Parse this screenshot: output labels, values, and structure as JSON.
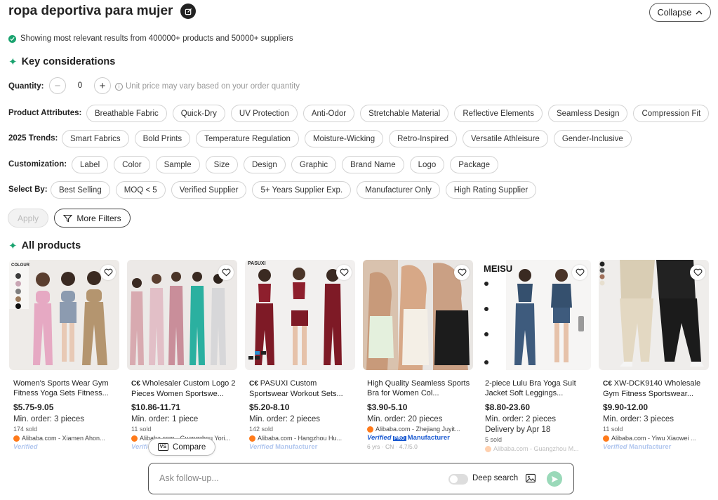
{
  "header": {
    "title": "ropa deportiva para mujer",
    "collapse_label": "Collapse"
  },
  "summary": {
    "showing_text": "Showing most relevant results from 400000+ products and 50000+ suppliers"
  },
  "key_considerations": {
    "heading": "Key considerations",
    "quantity_label": "Quantity:",
    "quantity_value": "0",
    "quantity_note": "Unit price may vary based on your order quantity",
    "product_attributes_label": "Product Attributes:",
    "product_attributes": [
      "Breathable Fabric",
      "Quick-Dry",
      "UV Protection",
      "Anti-Odor",
      "Stretchable Material",
      "Reflective Elements",
      "Seamless Design",
      "Compression Fit"
    ],
    "trends_label": "2025 Trends:",
    "trends": [
      "Smart Fabrics",
      "Bold Prints",
      "Temperature Regulation",
      "Moisture-Wicking",
      "Retro-Inspired",
      "Versatile Athleisure",
      "Gender-Inclusive"
    ],
    "customization_label": "Customization:",
    "customization": [
      "Label",
      "Color",
      "Sample",
      "Size",
      "Design",
      "Graphic",
      "Brand Name",
      "Logo",
      "Package"
    ],
    "select_by_label": "Select By:",
    "select_by": [
      "Best Selling",
      "MOQ < 5",
      "Verified Supplier",
      "5+ Years Supplier Exp.",
      "Manufacturer Only",
      "High Rating Supplier"
    ],
    "apply_label": "Apply",
    "more_filters_label": "More Filters"
  },
  "all_products": {
    "heading": "All products",
    "items": [
      {
        "name": "Women's Sports Wear Gym Fitness Yoga Sets Fitness...",
        "ce": "",
        "price": "$5.75-9.05",
        "min_order": "Min. order: 3 pieces",
        "delivery": "",
        "sold": "174 sold",
        "supplier": "Alibaba.com - Xiamen Ahon...",
        "verified": "Verified",
        "verified_extra": "",
        "meta": ""
      },
      {
        "name": "Wholesaler Custom Logo 2 Pieces Women Sportswe...",
        "ce": "C€",
        "price": "$10.86-11.71",
        "min_order": "Min. order: 1 piece",
        "delivery": "",
        "sold": "11 sold",
        "supplier": "Alibaba.com - Guangzhou Yori...",
        "verified": "Verified",
        "verified_extra": "",
        "meta": ""
      },
      {
        "name": "PASUXI Custom Sportswear Workout Sets...",
        "ce": "C€",
        "price": "$5.20-8.10",
        "min_order": "Min. order: 2 pieces",
        "delivery": "",
        "sold": "142 sold",
        "supplier": "Alibaba.com - Hangzhou Hu...",
        "verified": "Verified",
        "verified_extra": "Manufacturer",
        "meta": ""
      },
      {
        "name": "High Quality Seamless Sports Bra for Women Col...",
        "ce": "",
        "price": "$3.90-5.10",
        "min_order": "Min. order: 20 pieces",
        "delivery": "",
        "sold": "",
        "supplier": "Alibaba.com - Zhejiang Juyit...",
        "verified": "Verified",
        "verified_extra": "Manufacturer",
        "meta": "6 yrs · CN · 4.7/5.0"
      },
      {
        "name": "2-piece Lulu Bra Yoga Suit Jacket Soft Leggings...",
        "ce": "",
        "price": "$8.80-23.60",
        "min_order": "Min. order: 2 pieces",
        "delivery": "Delivery by Apr 18",
        "sold": "5 sold",
        "supplier": "Alibaba.com - Guangzhou M...",
        "verified": "",
        "verified_extra": "",
        "meta": ""
      },
      {
        "name": "XW-DCK9140 Wholesale Gym Fitness Sportswear...",
        "ce": "C€",
        "price": "$9.90-12.00",
        "min_order": "Min. order: 3 pieces",
        "delivery": "",
        "sold": "11 sold",
        "supplier": "Alibaba.com - Yiwu Xiaowei ...",
        "verified": "Verified",
        "verified_extra": "Manufacturer",
        "meta": ""
      }
    ],
    "image_text": {
      "colour_label": "COLOUR",
      "pasuxi_logo": "PASUXI",
      "meisu_logo": "MEISU"
    }
  },
  "compare": {
    "label": "Compare",
    "badge": "VS"
  },
  "followup": {
    "placeholder": "Ask follow-up...",
    "deep_search_label": "Deep search"
  },
  "colors": {
    "accent_green": "#1aa36f",
    "verified_blue": "#1d5cd1",
    "alibaba_orange": "#ff7a1a"
  }
}
